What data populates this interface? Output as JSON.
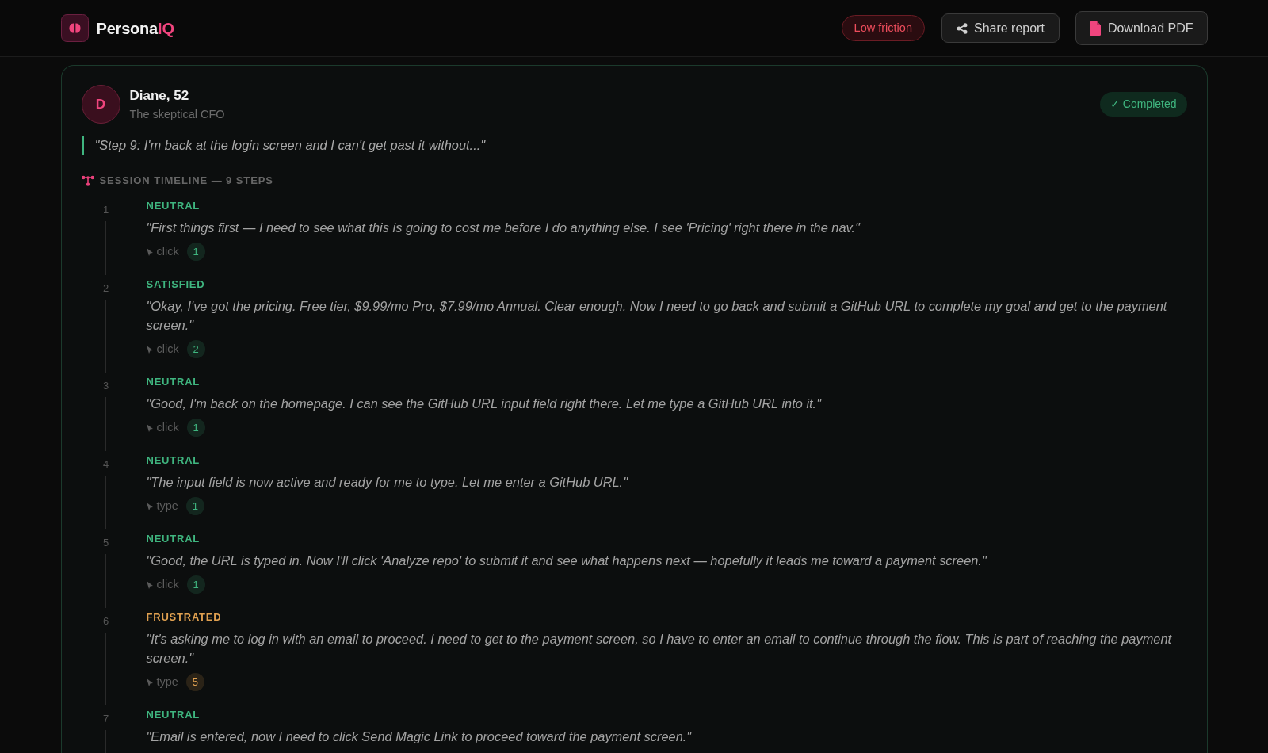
{
  "header": {
    "logo": {
      "text": "Persona",
      "accent": "IQ"
    },
    "friction_badge": "Low friction",
    "buttons": [
      {
        "kind": "share",
        "label": "Share report"
      },
      {
        "kind": "download",
        "label": "Download PDF"
      }
    ]
  },
  "persona": {
    "initial": "D",
    "name": "Diane, 52",
    "role": "The skeptical CFO",
    "status": "✓ Completed",
    "last_quote": "\"Step 9: I'm back at the login screen and I can't get past it without...\""
  },
  "timeline": {
    "heading": "SESSION TIMELINE — 9 STEPS",
    "steps": [
      {
        "number": "1",
        "mood": "NEUTRAL",
        "color": "#3fb57f",
        "quote": "\"First things first — I need to see what this is going to cost me before I do anything else. I see 'Pricing' right there in the nav.\"",
        "action": {
          "label": "click",
          "count": "1"
        }
      },
      {
        "number": "2",
        "mood": "SATISFIED",
        "color": "#3fb57f",
        "quote": "\"Okay, I've got the pricing. Free tier, $9.99/mo Pro, $7.99/mo Annual. Clear enough. Now I need to go back and submit a GitHub URL to complete my goal and get to the payment screen.\"",
        "action": {
          "label": "click",
          "count": "2"
        }
      },
      {
        "number": "3",
        "mood": "NEUTRAL",
        "color": "#3fb57f",
        "quote": "\"Good, I'm back on the homepage. I can see the GitHub URL input field right there. Let me type a GitHub URL into it.\"",
        "action": {
          "label": "click",
          "count": "1"
        }
      },
      {
        "number": "4",
        "mood": "NEUTRAL",
        "color": "#3fb57f",
        "quote": "\"The input field is now active and ready for me to type. Let me enter a GitHub URL.\"",
        "action": {
          "label": "type",
          "count": "1"
        }
      },
      {
        "number": "5",
        "mood": "NEUTRAL",
        "color": "#3fb57f",
        "quote": "\"Good, the URL is typed in. Now I'll click 'Analyze repo' to submit it and see what happens next — hopefully it leads me toward a payment screen.\"",
        "action": {
          "label": "click",
          "count": "1"
        }
      },
      {
        "number": "6",
        "mood": "FRUSTRATED",
        "color": "#e0a050",
        "quote": "\"It's asking me to log in with an email to proceed. I need to get to the payment screen, so I have to enter an email to continue through the flow. This is part of reaching the payment screen.\"",
        "action": {
          "label": "type",
          "count": "5"
        }
      },
      {
        "number": "7",
        "mood": "NEUTRAL",
        "color": "#3fb57f",
        "quote": "\"Email is entered, now I need to click Send Magic Link to proceed toward the payment screen.\""
      }
    ]
  }
}
